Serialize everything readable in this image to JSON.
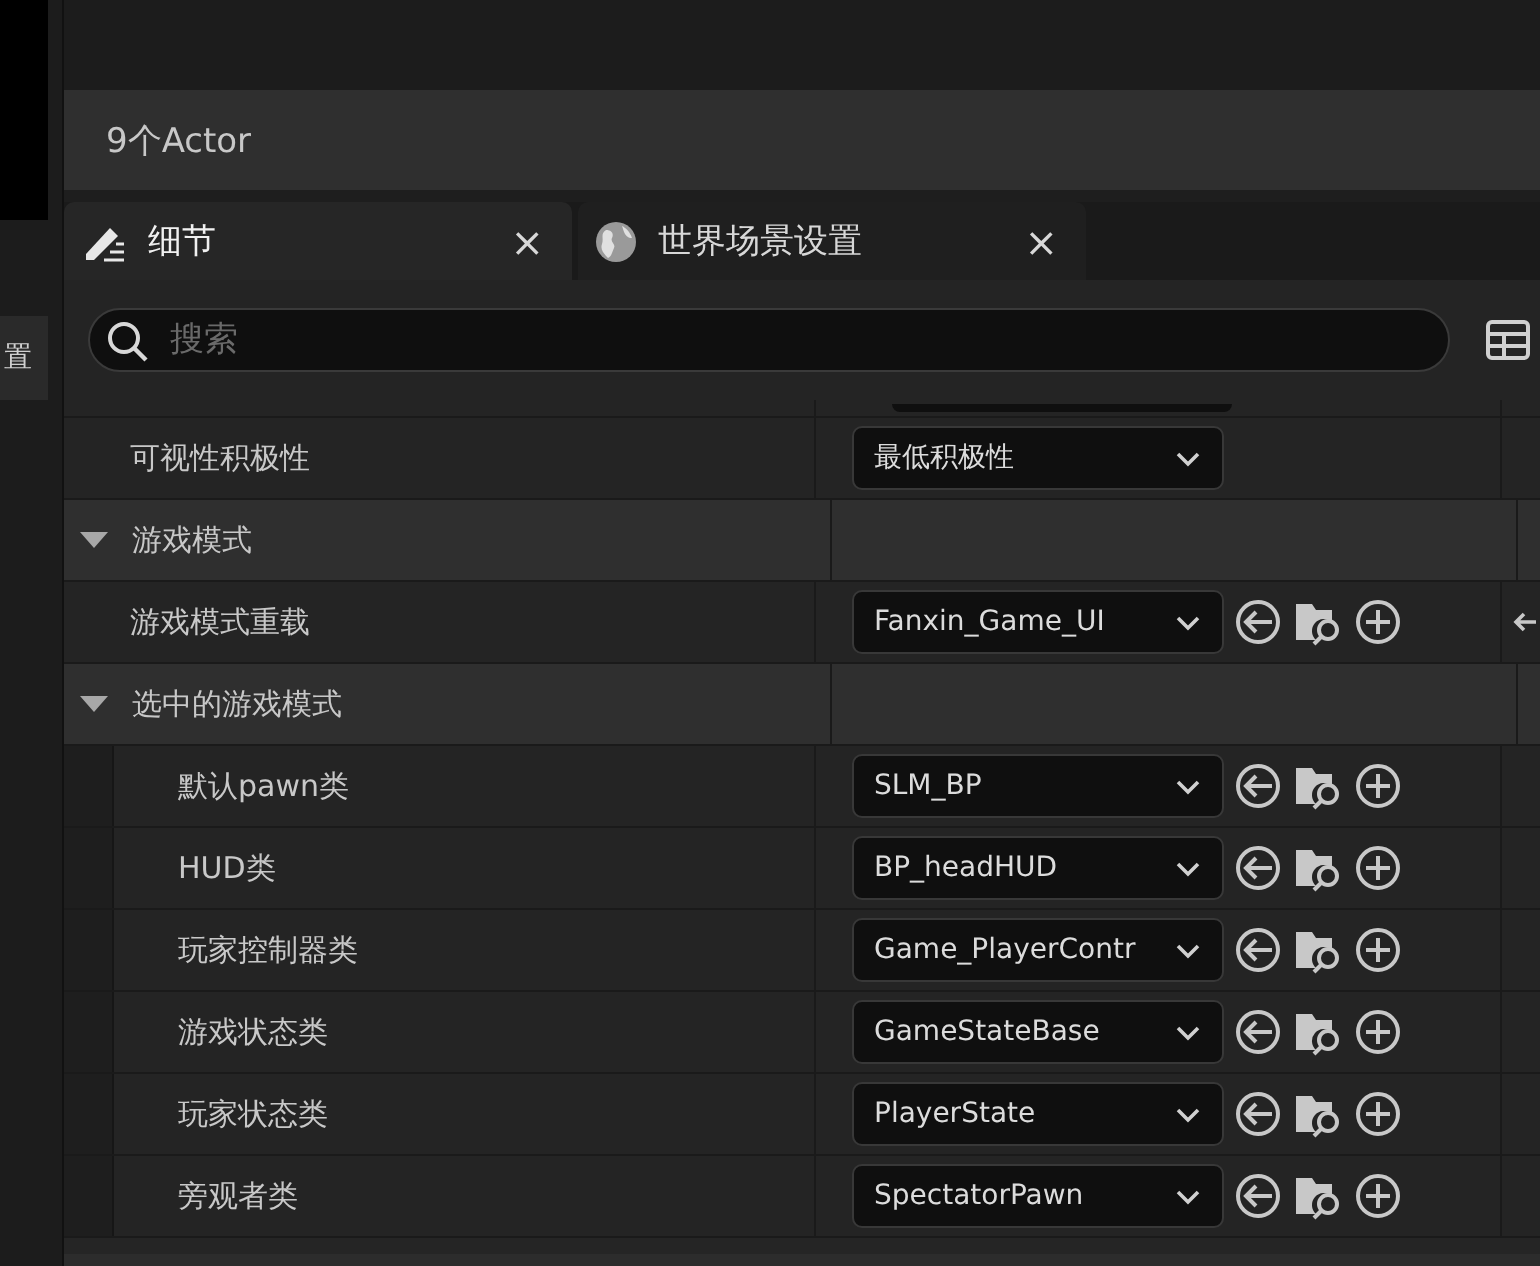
{
  "side_panel": {
    "label": "置"
  },
  "header": {
    "title": "9个Actor"
  },
  "tabs": [
    {
      "label": "细节",
      "selected": true,
      "close": "×"
    },
    {
      "label": "世界场景设置",
      "selected": false,
      "close": "×"
    }
  ],
  "search": {
    "placeholder": "搜索"
  },
  "rows": [
    {
      "kind": "dropdown",
      "name": "可视性积极性",
      "value": "最低积极性"
    },
    {
      "kind": "category",
      "name": "游戏模式",
      "expanded": true,
      "children": [
        {
          "kind": "class-picker",
          "name": "游戏模式重载",
          "value": "Fanxin_Game_UI",
          "reset_default": true
        }
      ]
    },
    {
      "kind": "category",
      "name": "选中的游戏模式",
      "expanded": true,
      "children": [
        {
          "kind": "class-picker",
          "name": "默认pawn类",
          "value": "SLM_BP"
        },
        {
          "kind": "class-picker",
          "name": "HUD类",
          "value": "BP_headHUD"
        },
        {
          "kind": "class-picker",
          "name": "玩家控制器类",
          "value": "Game_PlayerContr"
        },
        {
          "kind": "class-picker",
          "name": "游戏状态类",
          "value": "GameStateBase"
        },
        {
          "kind": "class-picker",
          "name": "玩家状态类",
          "value": "PlayerState"
        },
        {
          "kind": "class-picker",
          "name": "旁观者类",
          "value": "SpectatorPawn"
        }
      ]
    }
  ]
}
